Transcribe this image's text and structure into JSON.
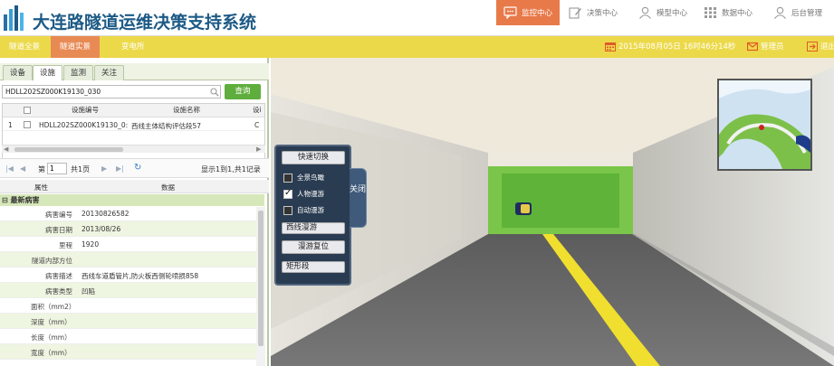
{
  "app": {
    "title": "大连路隧道运维决策支持系统"
  },
  "colors": {
    "accent": "#e87a4a",
    "subbar": "#ecd94a",
    "brand": "#1d5a86",
    "green_button": "#5fae3d"
  },
  "top_nav": [
    {
      "label": "监控中心",
      "icon": "chat-icon",
      "active": true
    },
    {
      "label": "决策中心",
      "icon": "edit-icon"
    },
    {
      "label": "模型中心",
      "icon": "user-icon"
    },
    {
      "label": "数据中心",
      "icon": "grid-icon"
    },
    {
      "label": "后台管理",
      "icon": "user-icon"
    }
  ],
  "sub_nav": [
    {
      "label": "隧道全景"
    },
    {
      "label": "隧道实景",
      "active": true
    },
    {
      "label": "变电所"
    }
  ],
  "status": {
    "datetime": "2015年08月05日 16时46分14秒",
    "user": "管理员",
    "logout": "退出"
  },
  "panel": {
    "tabs": [
      "设备",
      "设施",
      "监测",
      "关注"
    ],
    "active_tab": "设施",
    "search_value": "HDLL202SZ000K19130_030",
    "query_button": "查询",
    "table": {
      "columns": [
        "设施编号",
        "设施名称",
        "设i"
      ],
      "rows": [
        {
          "index": "1",
          "code": "HDLL202SZ000K19130_0:",
          "name": "西线主体结构评估段57",
          "extra": "C"
        }
      ]
    },
    "pager": {
      "page_label": "第",
      "page_value": "1",
      "total_label": "共1页",
      "summary": "显示1到1,共1记录"
    },
    "attributes": {
      "col_attr": "属性",
      "col_value": "数据",
      "group": "最新病害",
      "rows": [
        {
          "key": "病害编号",
          "value": "20130826582"
        },
        {
          "key": "病害日期",
          "value": "2013/08/26"
        },
        {
          "key": "里程",
          "value": "1920"
        },
        {
          "key": "隧道内部方位",
          "value": ""
        },
        {
          "key": "病害描述",
          "value": "西线车道盾管片,防火板西侧轮喷损858"
        },
        {
          "key": "病害类型",
          "value": "凹陷"
        },
        {
          "key": "面积（mm2）",
          "value": ""
        },
        {
          "key": "深度（mm）",
          "value": ""
        },
        {
          "key": "长度（mm）",
          "value": ""
        },
        {
          "key": "宽度（mm）",
          "value": ""
        }
      ]
    }
  },
  "control": {
    "quick_switch": "快速切换",
    "options": [
      {
        "label": "全景鸟瞰",
        "checked": false
      },
      {
        "label": "人物漫游",
        "checked": true
      },
      {
        "label": "自动漫游",
        "checked": false
      }
    ],
    "route": "西线漫游",
    "reset": "漫游复位",
    "segment": "矩形段",
    "side_tab": "关闭"
  }
}
